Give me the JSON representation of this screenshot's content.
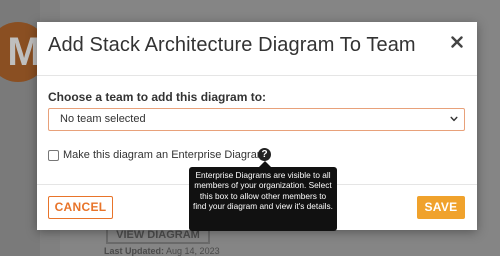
{
  "background": {
    "avatar_letter": "M",
    "view_button_label": "VIEW DIAGRAM",
    "last_updated_label": "Last Updated:",
    "last_updated_value": "Aug 14, 2023"
  },
  "modal": {
    "title": "Add Stack Architecture Diagram To Team",
    "close_icon": "close-icon",
    "team_field_label": "Choose a team to add this diagram to:",
    "team_select_value": "No team selected",
    "enterprise_checkbox_label": "Make this diagram an Enterprise Diagram",
    "enterprise_checked": false,
    "help_icon_glyph": "?",
    "tooltip_text": "Enterprise Diagrams are visible to all members of your organization. Select this box to allow other members to find your diagram and view it's details.",
    "cancel_label": "CANCEL",
    "save_label": "SAVE"
  },
  "colors": {
    "accent": "#e8742a",
    "save_button": "#f0a22c",
    "tooltip_bg": "#111111",
    "overlay": "#808080"
  }
}
